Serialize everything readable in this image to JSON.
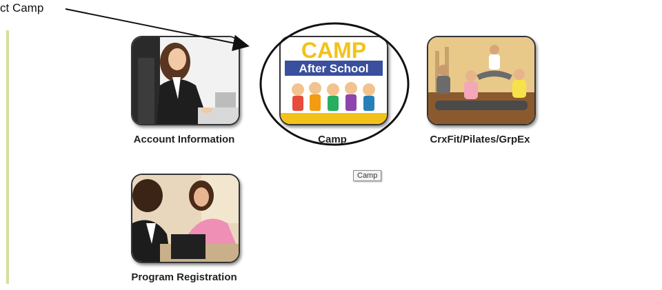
{
  "annotation": {
    "callout_text": "ct Camp"
  },
  "tiles": [
    {
      "label": "Account Information",
      "image": "businesswoman-at-desk-photo"
    },
    {
      "label": "Camp",
      "image": "camp-after-school-logo",
      "logo_title": "CAMP",
      "logo_subtitle": "After School"
    },
    {
      "label": "CrxFit/Pilates/GrpEx",
      "image": "pilates-class-photo"
    },
    {
      "label": "Program Registration",
      "image": "registration-desk-photo"
    }
  ],
  "tooltip": {
    "text": "Camp"
  },
  "colors": {
    "left_bar": "#d6df9c",
    "camp_blue": "#3a4f9d",
    "camp_yellow": "#f3c21a"
  }
}
